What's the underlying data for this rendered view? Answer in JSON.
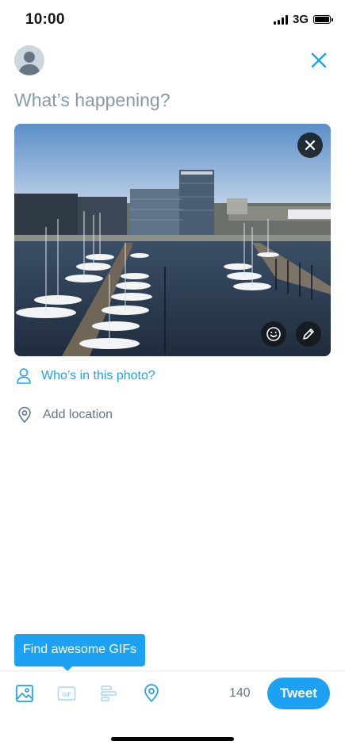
{
  "status_bar": {
    "time": "10:00",
    "network": "3G"
  },
  "compose": {
    "placeholder": "What’s happening?"
  },
  "photo_options": {
    "tag_people_label": "Who’s in this photo?",
    "add_location_label": "Add location"
  },
  "tooltip": {
    "text": "Find awesome GIFs"
  },
  "toolbar": {
    "char_count": "140",
    "tweet_label": "Tweet",
    "gif_label": "GIF"
  },
  "colors": {
    "accent": "#1da1f2",
    "muted": "#657786",
    "placeholder": "#8899a6",
    "disabled_icon": "#a5d4f7"
  },
  "icons": {
    "close": "close-icon",
    "avatar": "avatar-icon",
    "remove_photo": "close-icon",
    "sticker": "smiley-icon",
    "edit_photo": "pencil-icon",
    "person": "person-icon",
    "location": "location-pin-icon",
    "image": "image-icon",
    "gif": "gif-icon",
    "poll": "poll-icon",
    "location_toolbar": "location-pin-icon"
  }
}
